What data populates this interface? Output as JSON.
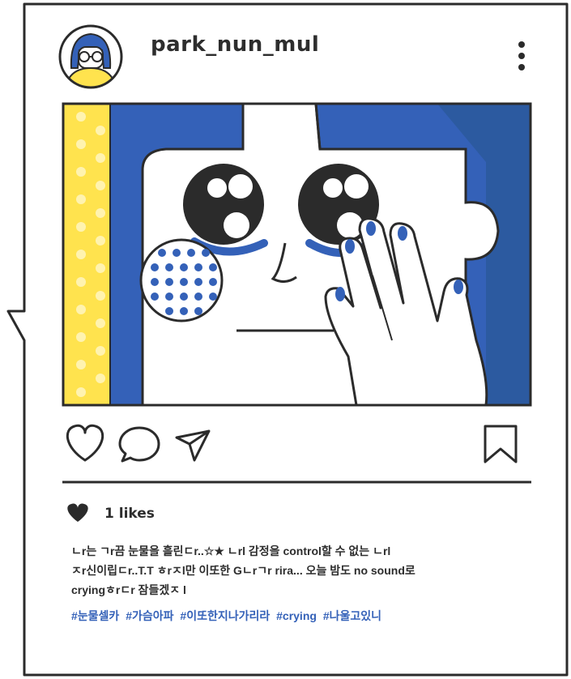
{
  "post": {
    "username": "park_nun_mul",
    "likes_text": "1 likes",
    "caption_lines": [
      "ㄴr는 ㄱr끔 눈물을 흘린ㄷr..☆★ ㄴrl 감정을 control할 수  없는 ㄴrl",
      "ㅈr신이립ㄷr..T.T ㅎrㅈl만 이또한 Gㄴrㄱr rira...  오늘 밤도 no sound로",
      "cryingㅎrㄷr 잠들겠ㅈ l"
    ],
    "hashtags": [
      "#눈물셀카",
      "#가슴아파",
      "#이또한지나가리라",
      "#crying",
      "#나울고있니"
    ]
  },
  "icons": {
    "avatar": "avatar",
    "more": "more-vertical-icon",
    "like": "heart-icon",
    "comment": "comment-bubble-icon",
    "share": "paper-plane-icon",
    "save": "bookmark-icon",
    "likes_indicator": "filled-heart-icon"
  },
  "colors": {
    "accent_blue": "#3461b8",
    "outline": "#2b2b2b",
    "yellow": "#ffe34e",
    "dark_blue": "#2c5aa0"
  }
}
